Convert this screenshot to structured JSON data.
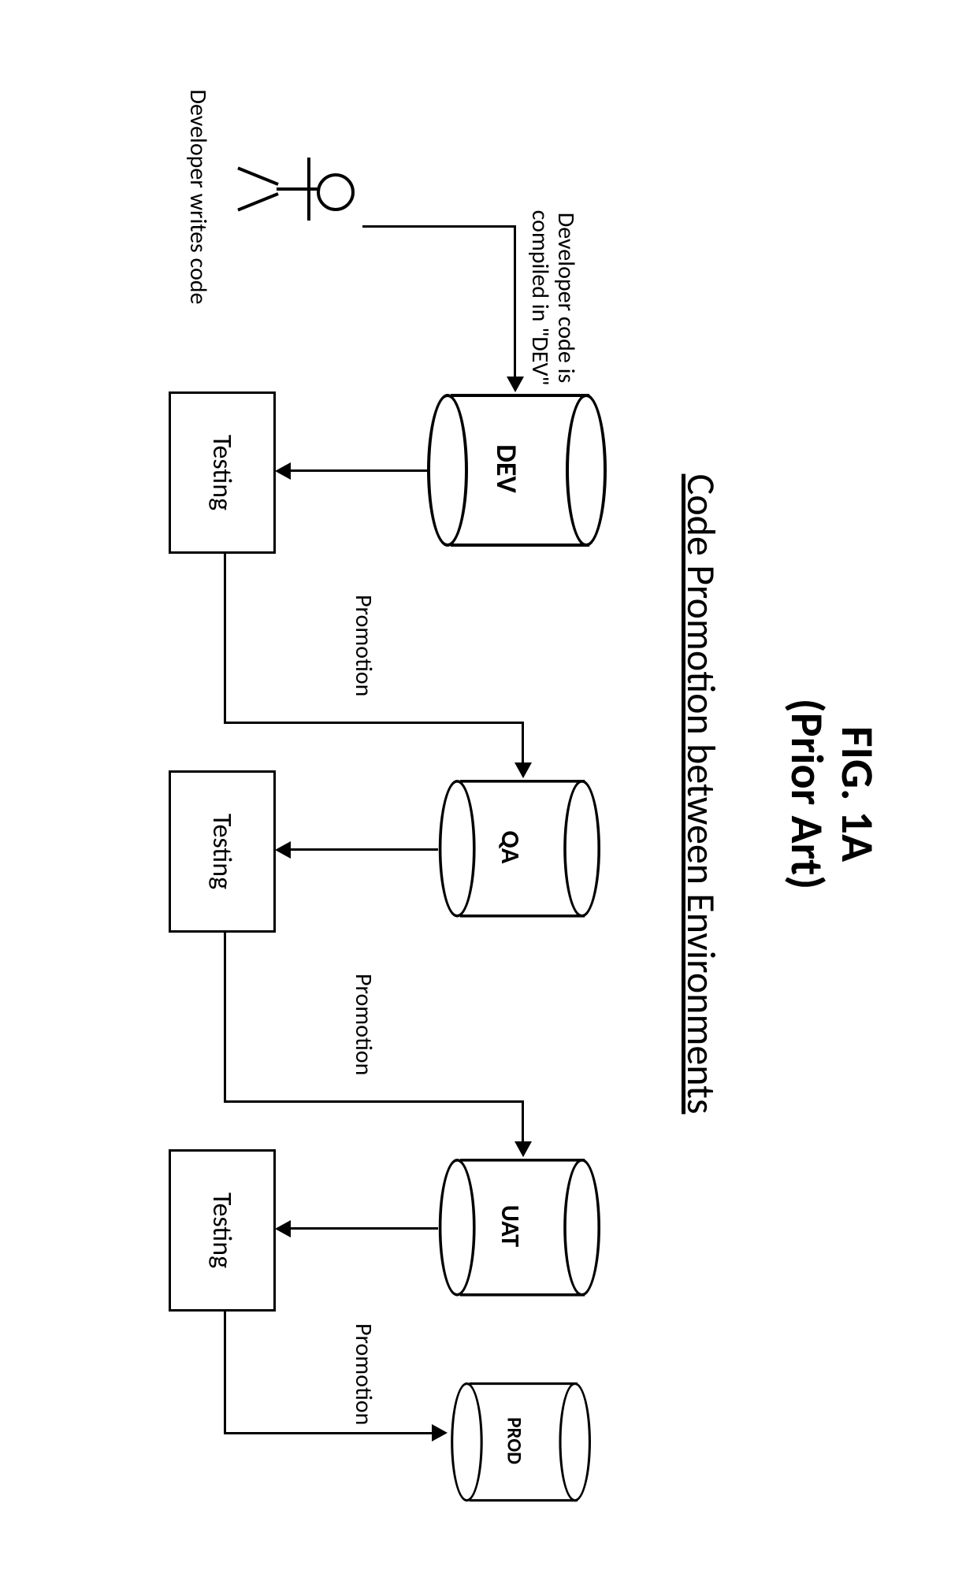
{
  "figure": {
    "title_line1": "FIG. 1A",
    "title_line2": "(Prior Art)",
    "subtitle": "Code Promotion between Environments"
  },
  "actor": {
    "caption": "Developer writes code"
  },
  "dev_entry": {
    "line1": "Developer code is",
    "line2": "compiled in \"DEV\""
  },
  "environments": {
    "dev": "DEV",
    "qa": "QA",
    "uat": "UAT",
    "prod": "PROD"
  },
  "process": {
    "testing": "Testing"
  },
  "transitions": {
    "promotion": "Promotion"
  },
  "chart_data": {
    "type": "diagram",
    "title": "Code Promotion between Environments",
    "nodes": [
      {
        "id": "developer",
        "type": "actor",
        "label": "Developer writes code"
      },
      {
        "id": "dev",
        "type": "datastore",
        "label": "DEV"
      },
      {
        "id": "test_dev",
        "type": "process",
        "label": "Testing"
      },
      {
        "id": "qa",
        "type": "datastore",
        "label": "QA"
      },
      {
        "id": "test_qa",
        "type": "process",
        "label": "Testing"
      },
      {
        "id": "uat",
        "type": "datastore",
        "label": "UAT"
      },
      {
        "id": "test_uat",
        "type": "process",
        "label": "Testing"
      },
      {
        "id": "prod",
        "type": "datastore",
        "label": "PROD"
      }
    ],
    "edges": [
      {
        "from": "developer",
        "to": "dev",
        "label": "Developer code is compiled in \"DEV\""
      },
      {
        "from": "dev",
        "to": "test_dev",
        "label": ""
      },
      {
        "from": "test_dev",
        "to": "qa",
        "label": "Promotion"
      },
      {
        "from": "qa",
        "to": "test_qa",
        "label": ""
      },
      {
        "from": "test_qa",
        "to": "uat",
        "label": "Promotion"
      },
      {
        "from": "uat",
        "to": "test_uat",
        "label": ""
      },
      {
        "from": "test_uat",
        "to": "prod",
        "label": "Promotion"
      }
    ]
  }
}
